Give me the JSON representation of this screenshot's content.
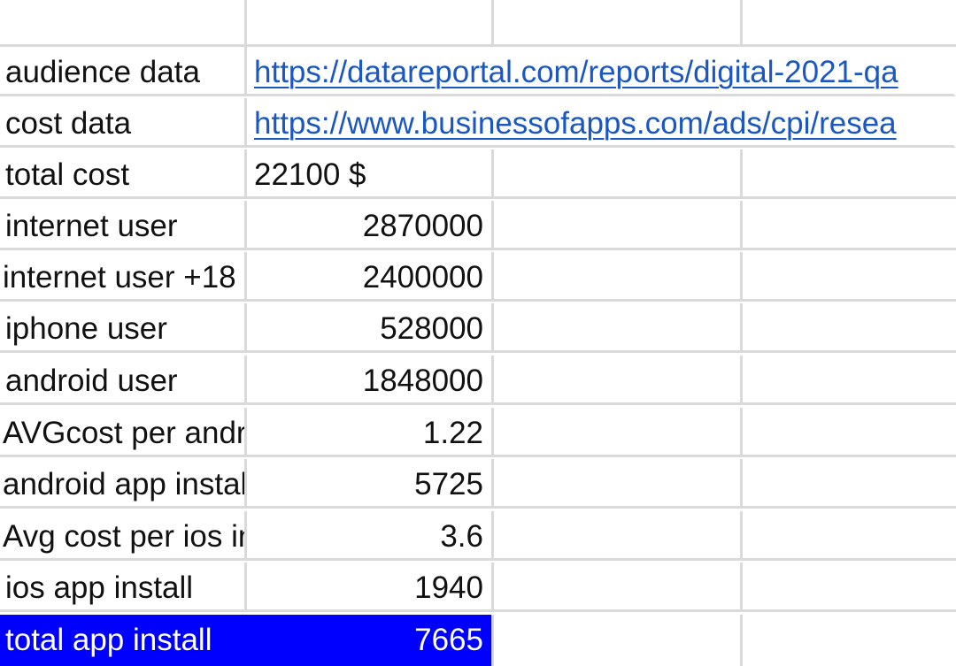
{
  "sheet": {
    "rows": [
      {
        "label": "",
        "value": "",
        "type": "empty"
      },
      {
        "label": "audience data",
        "value": "https://datareportal.com/reports/digital-2021-qa",
        "type": "link"
      },
      {
        "label": "cost data",
        "value": "https://www.businessofapps.com/ads/cpi/resea",
        "type": "link"
      },
      {
        "label": "total cost",
        "value": "22100 $",
        "type": "text"
      },
      {
        "label": "internet user",
        "value": "2870000",
        "type": "number"
      },
      {
        "label": "internet user +18",
        "value": "2400000",
        "type": "number"
      },
      {
        "label": "iphone user",
        "value": "528000",
        "type": "number"
      },
      {
        "label": "android user",
        "value": "1848000",
        "type": "number"
      },
      {
        "label": "AVGcost per android install",
        "value": "1.22",
        "type": "number"
      },
      {
        "label": "android app install",
        "value": "5725",
        "type": "number"
      },
      {
        "label": "Avg cost per ios install",
        "value": "3.6",
        "type": "number"
      },
      {
        "label": "ios app install",
        "value": "1940",
        "type": "number"
      },
      {
        "label": "total app install",
        "value": "7665",
        "type": "number",
        "highlight": true
      }
    ],
    "highlight_color": "#0000ff",
    "link_color": "#1a56c4",
    "gridline_color": "#dadada"
  }
}
